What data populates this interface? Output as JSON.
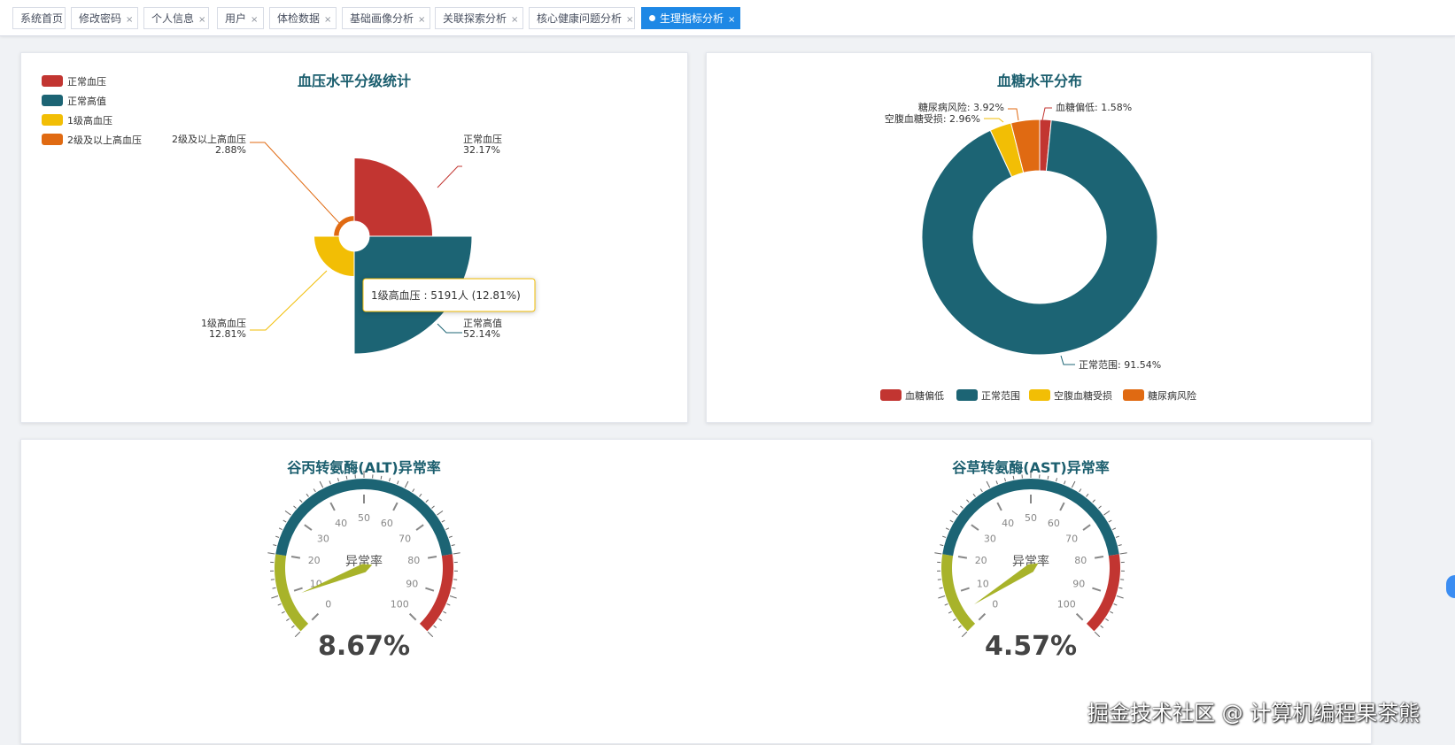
{
  "tabs": [
    {
      "label": "系统首页",
      "closable": false,
      "active": false
    },
    {
      "label": "修改密码",
      "closable": true,
      "active": false
    },
    {
      "label": "个人信息",
      "closable": true,
      "active": false
    },
    {
      "label": "用户",
      "closable": true,
      "active": false
    },
    {
      "label": "体检数据",
      "closable": true,
      "active": false
    },
    {
      "label": "基础画像分析",
      "closable": true,
      "active": false
    },
    {
      "label": "关联探索分析",
      "closable": true,
      "active": false
    },
    {
      "label": "核心健康问题分析",
      "closable": true,
      "active": false
    },
    {
      "label": "生理指标分析",
      "closable": true,
      "active": true
    }
  ],
  "tab_close_glyph": "×",
  "colors": {
    "red": "#c23531",
    "teal": "#1c6474",
    "yellow": "#f2be05",
    "orange": "#e06a12",
    "olive": "#a8b32a",
    "title": "#1b5e6e",
    "active_tab": "#1e88e5"
  },
  "bp_chart": {
    "title": "血压水平分级统计",
    "legend": [
      "正常血压",
      "正常高值",
      "1级高血压",
      "2级及以上高血压"
    ],
    "labels": [
      {
        "name": "正常血压",
        "pct": "32.17%"
      },
      {
        "name": "正常高值",
        "pct": "52.14%"
      },
      {
        "name": "1级高血压",
        "pct": "12.81%"
      },
      {
        "name": "2级及以上高血压",
        "pct": "2.88%"
      }
    ],
    "tooltip": "1级高血压 : 5191人 (12.81%)"
  },
  "glucose_chart": {
    "title": "血糖水平分布",
    "legend": [
      "血糖偏低",
      "正常范围",
      "空腹血糖受损",
      "糖尿病风险"
    ],
    "labels": [
      "血糖偏低: 1.58%",
      "正常范围: 91.54%",
      "空腹血糖受损: 2.96%",
      "糖尿病风险: 3.92%"
    ]
  },
  "gauges": [
    {
      "title": "谷丙转氨酶(ALT)异常率",
      "label": "异常率",
      "value_text": "8.67%"
    },
    {
      "title": "谷草转氨酶(AST)异常率",
      "label": "异常率",
      "value_text": "4.57%"
    }
  ],
  "gauge_ticks": [
    "0",
    "10",
    "20",
    "30",
    "40",
    "50",
    "60",
    "70",
    "80",
    "90",
    "100"
  ],
  "watermark": "掘金技术社区 @ 计算机编程果茶熊",
  "chart_data": [
    {
      "type": "pie",
      "variant": "rose",
      "title": "血压水平分级统计",
      "categories": [
        "正常血压",
        "正常高值",
        "1级高血压",
        "2级及以上高血压"
      ],
      "values": [
        32.17,
        52.14,
        12.81,
        2.88
      ],
      "legend": "top-left"
    },
    {
      "type": "pie",
      "variant": "donut",
      "title": "血糖水平分布",
      "categories": [
        "血糖偏低",
        "正常范围",
        "空腹血糖受损",
        "糖尿病风险"
      ],
      "values": [
        1.58,
        91.54,
        2.96,
        3.92
      ],
      "legend": "bottom"
    },
    {
      "type": "gauge",
      "title": "谷丙转氨酶(ALT)异常率",
      "value": 8.67,
      "range": [
        0,
        100
      ],
      "bands": [
        {
          "upto": 20,
          "color": "#a8b32a"
        },
        {
          "upto": 80,
          "color": "#1c6474"
        },
        {
          "upto": 100,
          "color": "#c23531"
        }
      ]
    },
    {
      "type": "gauge",
      "title": "谷草转氨酶(AST)异常率",
      "value": 4.57,
      "range": [
        0,
        100
      ],
      "bands": [
        {
          "upto": 20,
          "color": "#a8b32a"
        },
        {
          "upto": 80,
          "color": "#1c6474"
        },
        {
          "upto": 100,
          "color": "#c23531"
        }
      ]
    }
  ]
}
